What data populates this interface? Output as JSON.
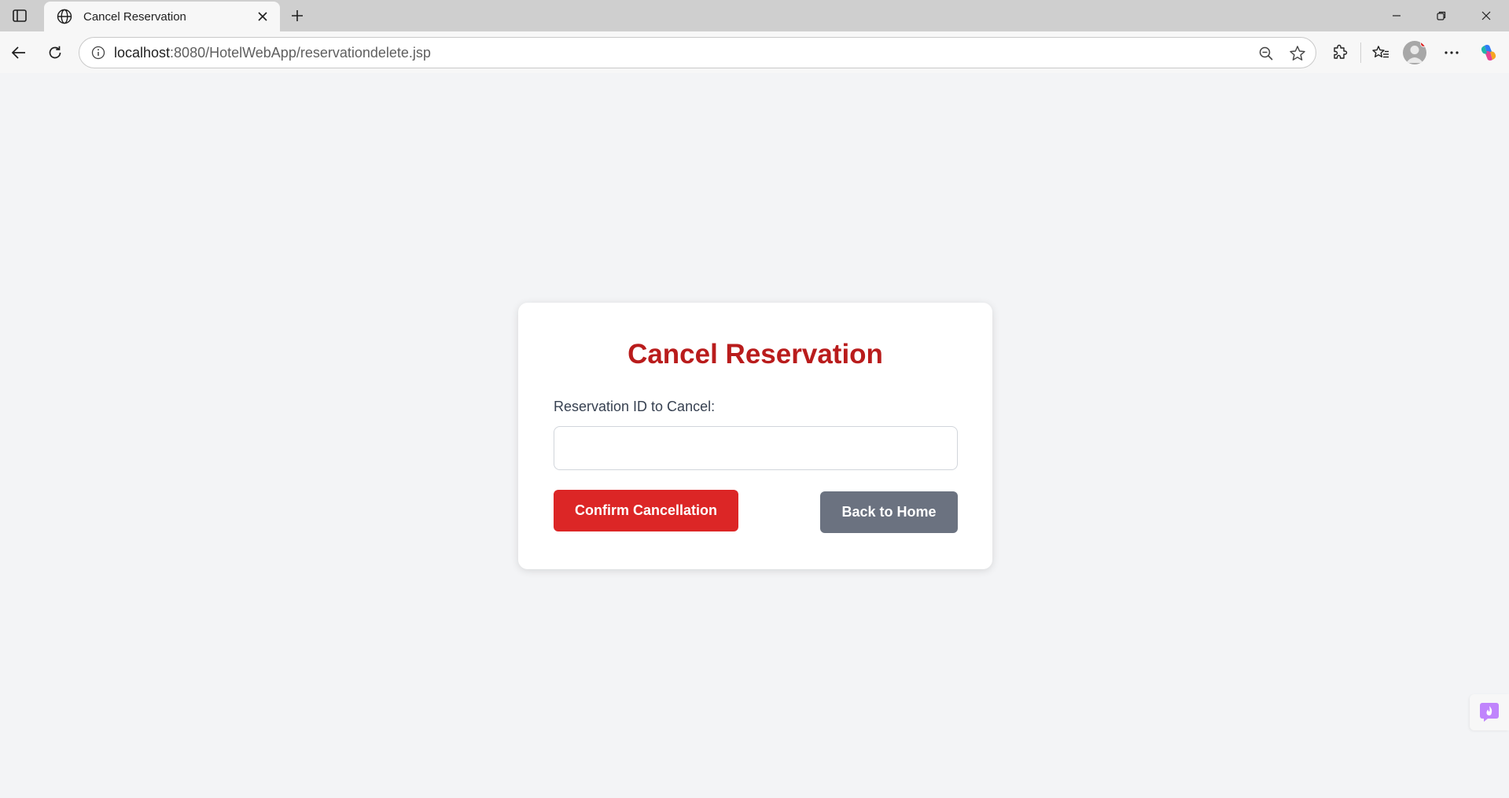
{
  "browser": {
    "tab": {
      "title": "Cancel Reservation",
      "favicon": "globe-icon"
    },
    "address": {
      "host": "localhost",
      "path": ":8080/HotelWebApp/reservationdelete.jsp"
    },
    "icons": {
      "sidebar": "tab-sidebar-icon",
      "close": "close-icon",
      "new_tab": "plus-icon",
      "minimize": "minimize-icon",
      "restore": "restore-icon",
      "window_close": "window-close-icon",
      "back": "back-arrow-icon",
      "refresh": "refresh-icon",
      "site_info": "info-icon",
      "zoom": "zoom-out-icon",
      "favorite": "star-icon",
      "extensions": "puzzle-icon",
      "favorites": "favorites-icon",
      "more": "more-icon",
      "copilot": "copilot-icon"
    },
    "colors": {
      "tabstrip": "#cfcfcf",
      "toolbar": "#f7f7f7"
    }
  },
  "page": {
    "heading": "Cancel Reservation",
    "field_label": "Reservation ID to Cancel:",
    "reservation_id_value": "",
    "confirm_label": "Confirm Cancellation",
    "home_label": "Back to Home",
    "colors": {
      "background": "#f3f4f6",
      "heading": "#b91c1c",
      "confirm_button": "#dc2626",
      "home_button": "#6b7280"
    }
  }
}
